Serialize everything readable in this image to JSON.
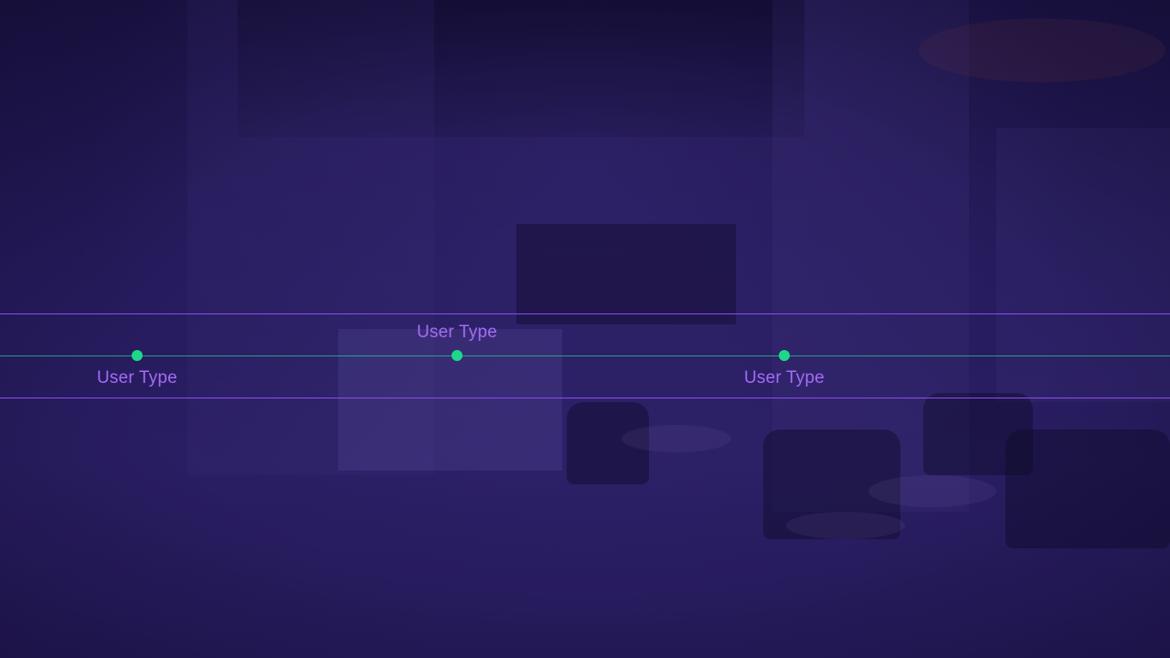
{
  "colors": {
    "background": "#241a5a",
    "band_line": "#8a4cf0",
    "axis_line": "#1fb98a",
    "dot": "#1ed889",
    "label": "#a46bf5"
  },
  "timeline": {
    "points": [
      {
        "label": "User Type",
        "position": "below"
      },
      {
        "label": "User Type",
        "position": "above"
      },
      {
        "label": "User Type",
        "position": "below"
      }
    ]
  }
}
